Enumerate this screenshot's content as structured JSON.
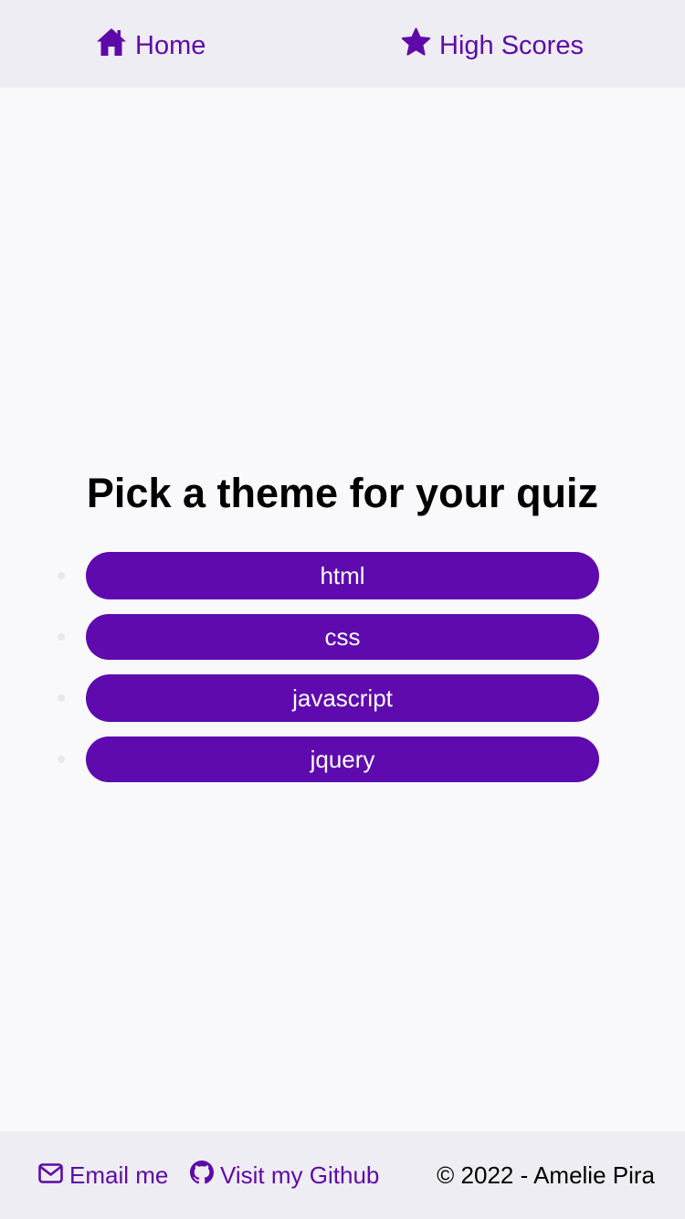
{
  "nav": {
    "home_label": "Home",
    "home_icon": "home-icon",
    "scores_label": "High Scores",
    "scores_icon": "star-icon"
  },
  "main": {
    "title": "Pick a theme for your quiz",
    "themes": [
      {
        "label": "html"
      },
      {
        "label": "css"
      },
      {
        "label": "javascript"
      },
      {
        "label": "jquery"
      }
    ]
  },
  "footer": {
    "email_label": "Email me",
    "email_icon": "envelope-icon",
    "github_label": "Visit my Github",
    "github_icon": "github-icon",
    "copyright": "© 2022 - Amelie Pira"
  },
  "colors": {
    "accent": "#5e0aaf",
    "link": "#5e0aa8",
    "bar_background": "#efedf4",
    "page_background": "#f9f9fb"
  }
}
